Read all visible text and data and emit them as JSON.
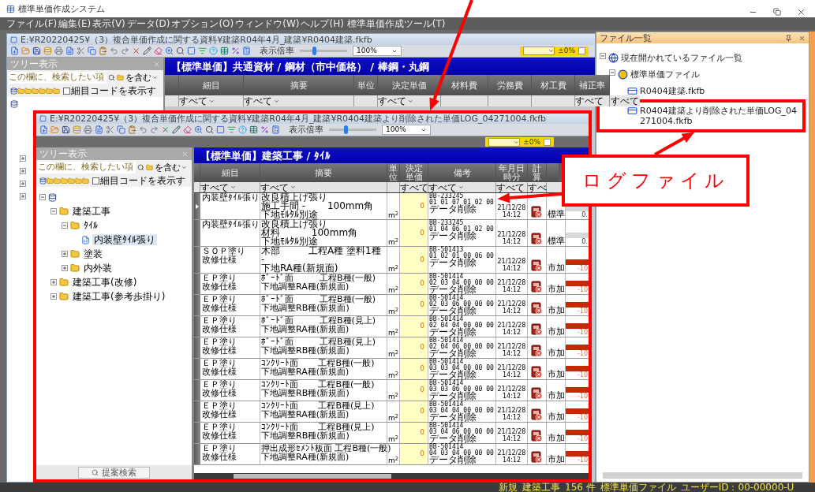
{
  "app": {
    "title": "標準単価作成システム"
  },
  "menu": [
    "ファイル(F)",
    "編集(E)",
    "表示(V)",
    "データ(D)",
    "オプション(O)",
    "ウィンドウ(W)",
    "ヘルプ(H)",
    "標準単価作成ツール(T)"
  ],
  "back_window": {
    "title": "E:¥R20220425¥（3）複合単価作成に関する資料¥建築R04年4月_建築¥R0404建築.fkfb",
    "zoom": {
      "label": "表示倍率",
      "level": 0.3,
      "value": "100%"
    },
    "rate": "±0%",
    "tree_panel": {
      "title": "ツリー表示",
      "search_placeholder": "この欄に、検索したい項",
      "match": "を含む",
      "show_codes": {
        "label": "細目コードを表示す",
        "checked": false
      }
    },
    "header": "【標準単価】共通資材 / 鋼材（市中価格） / 棒鋼・丸鋼",
    "columns": [
      {
        "label": "細目",
        "filter": "すべて"
      },
      {
        "label": "摘要",
        "filter": "すべて"
      },
      {
        "label": "単位"
      },
      {
        "label": "決定単価",
        "filter": "すべて"
      },
      {
        "label": "材料費"
      },
      {
        "label": "労務費"
      },
      {
        "label": "材工費"
      },
      {
        "label": "補正率",
        "filter": "すべて"
      },
      {
        "filter": "すべて"
      }
    ]
  },
  "front_window": {
    "title": "E:¥R20220425¥（3）複合単価作成に関する資料¥建築R04年4月_建築¥R0404建築より削除された単価LOG_04271004.fkfb",
    "zoom": {
      "label": "表示倍率",
      "level": 0.35,
      "value": "100%"
    },
    "rate": "±0%",
    "tree_panel": {
      "title": "ツリー表示",
      "search_placeholder": "この欄に、検索したい項",
      "match": "を含む",
      "show_codes": {
        "label": "細目コードを表示す",
        "checked": false
      },
      "tree": [
        {
          "expanded": true,
          "children": [
            {
              "label": "建築工事",
              "expanded": true,
              "selected": false,
              "children": [
                {
                  "label": "ﾀｲﾙ",
                  "expanded": true,
                  "selected": false,
                  "children": [
                    {
                      "label": "内装壁ﾀｲﾙ張り",
                      "selected": true
                    }
                  ]
                },
                {
                  "label": "塗装",
                  "expanded": false,
                  "selected": false
                },
                {
                  "label": "内外装",
                  "expanded": false,
                  "selected": false
                }
              ]
            },
            {
              "label": "建築工事(改修)",
              "expanded": false,
              "selected": false
            },
            {
              "label": "建築工事(参考歩掛り)",
              "expanded": false,
              "selected": false
            }
          ]
        }
      ],
      "search_button": "提案検索"
    },
    "header": "【標準単価】建築工事 / ﾀｲﾙ",
    "columns": [
      {
        "label": "細目",
        "filter": "すべて"
      },
      {
        "label": "摘要",
        "filter": "すべて"
      },
      {
        "label": "単位"
      },
      {
        "label": "決定単価",
        "filter": "すべて"
      },
      {
        "label": "備考",
        "filter": "すべて"
      },
      {
        "label": "年月日時分",
        "filter": "すべて"
      },
      {
        "label": "計算",
        "filter": "すべ"
      }
    ],
    "rows": [
      {
        "selected": true,
        "kind": "standard",
        "item": [
          "内装壁ﾀｲﾙ張り"
        ],
        "summary": [
          "改良積上げ張り",
          "施工手間 -　　 100mm角",
          "下地ﾓﾙﾀﾙ別途"
        ],
        "unit": "m$^{2}$",
        "price": "0",
        "code": "BB-233245",
        "digits": "01 01 07 01 02 00",
        "note": "データ削除",
        "date": "21/12/28",
        "time": "14:12",
        "type": "標準",
        "value": "0."
      },
      {
        "selected": false,
        "kind": "standard",
        "item": [
          "内装壁ﾀｲﾙ張り"
        ],
        "summary": [
          "改良積上げ張り",
          "材料　　　 100mm角",
          "下地ﾓﾙﾀﾙ別途"
        ],
        "unit": "m$^{2}$",
        "price": "0",
        "code": "BB-233245",
        "digits": "01 04 06 01 02 00",
        "note": "データ削除",
        "date": "21/12/28",
        "time": "14:12",
        "type": "標準",
        "value": "0."
      },
      {
        "selected": false,
        "kind": "market",
        "item": [
          "ＳＯＰ塗り",
          "改修仕様"
        ],
        "summary": [
          "木部　　　工程A種 塗料1種",
          "-",
          "下地RA種(新規面)"
        ],
        "unit": "m$^{2}$",
        "price": "0",
        "code": "BB-501413",
        "digits": "01 02 01 00 06 00",
        "note": "データ削除",
        "date": "21/12/28",
        "time": "14:12",
        "type": "市加",
        "value": "-10"
      },
      {
        "selected": false,
        "kind": "market",
        "item": [
          "ＥＰ塗り",
          "改修仕様"
        ],
        "summary": [
          "ﾎﾞｰﾄﾞ面　　　工程B種(一般)",
          "下地調整RA種(新規面)"
        ],
        "unit": "m$^{2}$",
        "price": "0",
        "code": "BB-501414",
        "digits": "02 03 04 00 00 00",
        "note": "データ削除",
        "date": "21/12/28",
        "time": "14:12",
        "type": "市加",
        "value": "-10"
      },
      {
        "selected": false,
        "kind": "market",
        "item": [
          "ＥＰ塗り",
          "改修仕様"
        ],
        "summary": [
          "ﾎﾞｰﾄﾞ面　　　工程B種(一般)",
          "下地調整RB種(新規面)"
        ],
        "unit": "m$^{2}$",
        "price": "0",
        "code": "BB-501414",
        "digits": "02 03 06 00 00 00",
        "note": "データ削除",
        "date": "21/12/28",
        "time": "14:12",
        "type": "市加",
        "value": "-10"
      },
      {
        "selected": false,
        "kind": "market",
        "item": [
          "ＥＰ塗り",
          "改修仕様"
        ],
        "summary": [
          "ﾎﾞｰﾄﾞ面　　　工程B種(見上)",
          "下地調整RA種(新規面)"
        ],
        "unit": "m$^{2}$",
        "price": "0",
        "code": "BB-501414",
        "digits": "02 04 04 00 00 00",
        "note": "データ削除",
        "date": "21/12/28",
        "time": "14:12",
        "type": "市加",
        "value": "-10"
      },
      {
        "selected": false,
        "kind": "market",
        "item": [
          "ＥＰ塗り",
          "改修仕様"
        ],
        "summary": [
          "ﾎﾞｰﾄﾞ面　　　工程B種(見上)",
          "下地調整RB種(新規面)"
        ],
        "unit": "m$^{2}$",
        "price": "0",
        "code": "BB-501414",
        "digits": "02 04 06 00 00 00",
        "note": "データ削除",
        "date": "21/12/28",
        "time": "14:12",
        "type": "市加",
        "value": "-10"
      },
      {
        "selected": false,
        "kind": "market",
        "item": [
          "ＥＰ塗り",
          "改修仕様"
        ],
        "summary": [
          "ｺﾝｸﾘｰﾄ面　　 工程B種(一般)",
          "下地調整RA種(新規面)"
        ],
        "unit": "m$^{2}$",
        "price": "0",
        "code": "BB-501414",
        "digits": "03 03 04 00 00 00",
        "note": "データ削除",
        "date": "21/12/28",
        "time": "14:12",
        "type": "市加",
        "value": "-10"
      },
      {
        "selected": false,
        "kind": "market",
        "item": [
          "ＥＰ塗り",
          "改修仕様"
        ],
        "summary": [
          "ｺﾝｸﾘｰﾄ面　　 工程B種(一般)",
          "下地調整RB種(新規面)"
        ],
        "unit": "m$^{2}$",
        "price": "0",
        "code": "BB-501414",
        "digits": "03 03 06 00 00 00",
        "note": "データ削除",
        "date": "21/12/28",
        "time": "14:12",
        "type": "市加",
        "value": "-10"
      },
      {
        "selected": false,
        "kind": "market",
        "item": [
          "ＥＰ塗り",
          "改修仕様"
        ],
        "summary": [
          "ｺﾝｸﾘｰﾄ面　　 工程B種(見上)",
          "下地調整RA種(新規面)"
        ],
        "unit": "m$^{2}$",
        "price": "0",
        "code": "BB-501414",
        "digits": "03 04 04 00 00 00",
        "note": "データ削除",
        "date": "21/12/28",
        "time": "14:12",
        "type": "市加",
        "value": "-10"
      },
      {
        "selected": false,
        "kind": "market",
        "item": [
          "ＥＰ塗り",
          "改修仕様"
        ],
        "summary": [
          "ｺﾝｸﾘｰﾄ面　　 工程B種(見上)",
          "下地調整RB種(新規面)"
        ],
        "unit": "m$^{2}$",
        "price": "0",
        "code": "BB-501414",
        "digits": "03 04 06 00 00 00",
        "note": "データ削除",
        "date": "21/12/28",
        "time": "14:12",
        "type": "市加",
        "value": "-10"
      },
      {
        "selected": false,
        "kind": "market",
        "item": [
          "ＥＰ塗り",
          "改修仕様"
        ],
        "summary": [
          "押出成形ｾﾒﾝﾄ板面 工程B種(一般)",
          "下地調整RA種(新規面)"
        ],
        "unit": "m$^{2}$",
        "price": "0",
        "code": "BB-501414",
        "digits": "04 03 04 00 00 00",
        "note": "データ削除",
        "date": "21/12/28",
        "time": "14:12",
        "type": "市加",
        "value": "-10"
      }
    ]
  },
  "file_panel": {
    "title": "ファイル一覧",
    "tree": [
      {
        "label": "現在開かれているファイル一覧",
        "expanded": true,
        "highlighted": false,
        "children": [
          {
            "label": "標準単価ファイル",
            "expanded": true,
            "highlighted": false,
            "children": [
              {
                "label": "R0404建築.fkfb",
                "highlighted": false
              },
              {
                "label": "R0404建築より削除された単価LOG_04271004.fkfb",
                "highlighted": true
              }
            ]
          }
        ]
      }
    ]
  },
  "callout": {
    "text": "ログファイル"
  },
  "status_bar": [
    "新規",
    "建築工事",
    "156 件",
    "標準単価ファイル",
    "ユーザーID：00-00000-U"
  ]
}
